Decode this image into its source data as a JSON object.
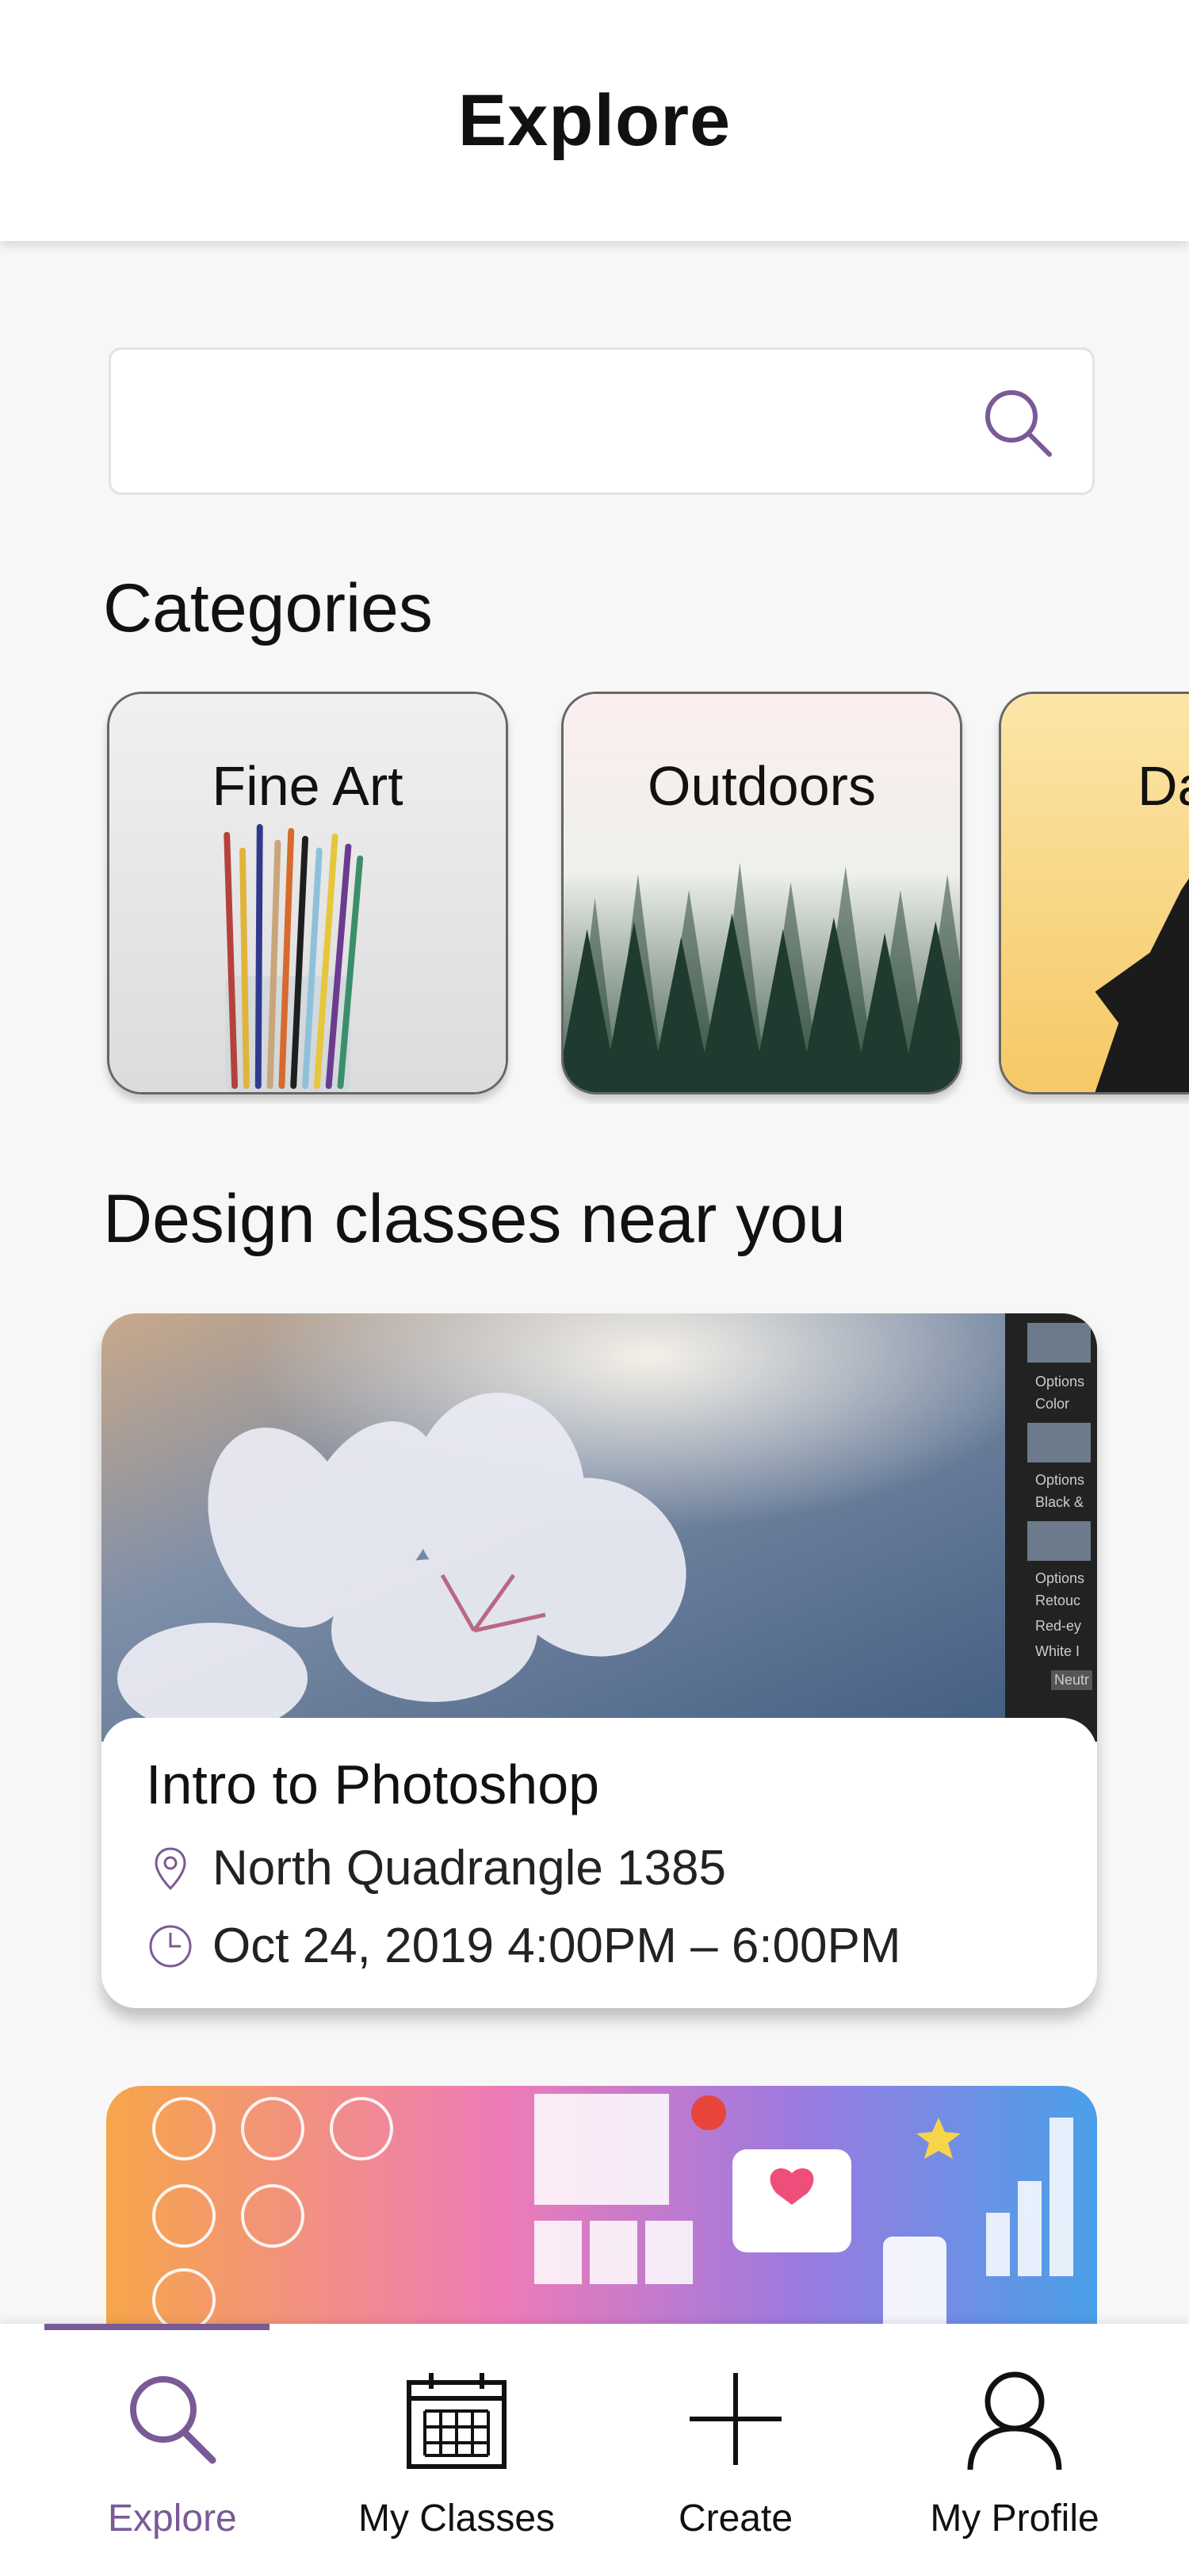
{
  "header": {
    "title": "Explore"
  },
  "search": {
    "value": "",
    "icon": "search-icon"
  },
  "categories_section": {
    "title": "Categories",
    "items": [
      {
        "label": "Fine Art"
      },
      {
        "label": "Outdoors"
      },
      {
        "label": "Da"
      }
    ]
  },
  "classes_section": {
    "title": "Design classes near you",
    "cards": [
      {
        "title": "Intro to Photoshop",
        "location": "North Quadrangle 1385",
        "datetime": "Oct 24, 2019 4:00PM – 6:00PM",
        "panel_labels": [
          "Options",
          "Color",
          "Options",
          "Black &",
          "Options",
          "Retouc",
          "Red-ey",
          "White I",
          "Neutr"
        ]
      }
    ]
  },
  "bottom_nav": {
    "items": [
      {
        "label": "Explore",
        "icon": "search-icon",
        "active": true
      },
      {
        "label": "My Classes",
        "icon": "calendar-icon",
        "active": false
      },
      {
        "label": "Create",
        "icon": "plus-icon",
        "active": false
      },
      {
        "label": "My Profile",
        "icon": "user-icon",
        "active": false
      }
    ]
  },
  "colors": {
    "accent": "#7a5a96",
    "background": "#f7f7f7",
    "header": "#ffffff"
  }
}
